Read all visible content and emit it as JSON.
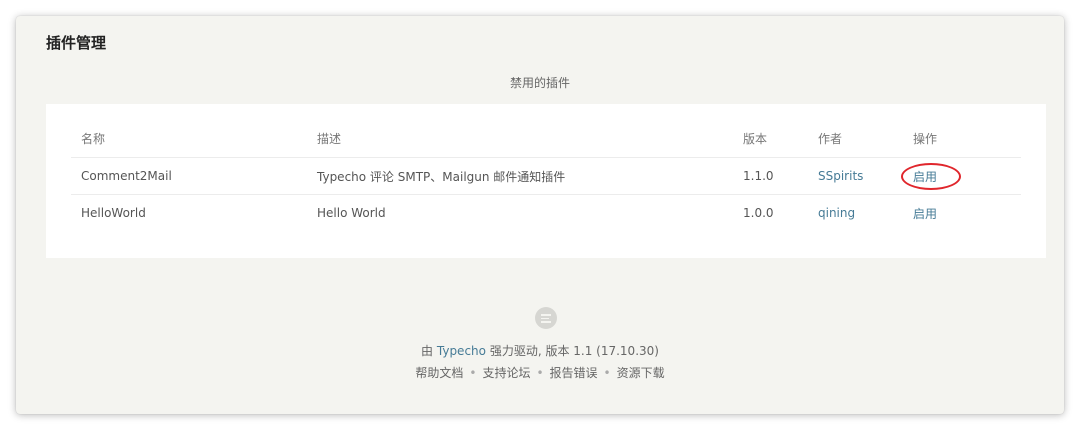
{
  "page": {
    "title": "插件管理",
    "section_title": "禁用的插件"
  },
  "table": {
    "headers": {
      "name": "名称",
      "description": "描述",
      "version": "版本",
      "author": "作者",
      "action": "操作"
    },
    "rows": [
      {
        "name": "Comment2Mail",
        "description": "Typecho 评论 SMTP、Mailgun 邮件通知插件",
        "version": "1.1.0",
        "author": "SSpirits",
        "action": "启用"
      },
      {
        "name": "HelloWorld",
        "description": "Hello World",
        "version": "1.0.0",
        "author": "qining",
        "action": "启用"
      }
    ]
  },
  "footer": {
    "prefix": "由",
    "brand_link": "Typecho",
    "suffix": "强力驱动, 版本 1.1 (17.10.30)",
    "links": [
      "帮助文档",
      "支持论坛",
      "报告错误",
      "资源下载"
    ],
    "separator": "•"
  },
  "colors": {
    "link": "#467b96",
    "highlight": "#e0262c",
    "background": "#f4f4f0"
  }
}
